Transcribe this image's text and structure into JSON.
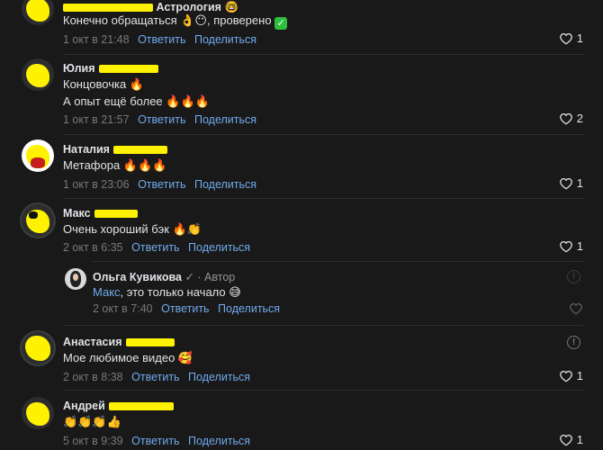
{
  "comments": [
    {
      "name": "Астрология",
      "text1": "Конечно обращаться 👌😶, проверено",
      "date": "1 окт в 21:48",
      "reply": "Ответить",
      "share": "Поделиться",
      "likes": "1"
    },
    {
      "name": "Юлия",
      "text1": "Концовочка 🔥",
      "text2": "А опыт ещё более 🔥🔥🔥",
      "date": "1 окт в 21:57",
      "reply": "Ответить",
      "share": "Поделиться",
      "likes": "2"
    },
    {
      "name": "Наталия",
      "text1": "Метафора 🔥🔥🔥",
      "date": "1 окт в 23:06",
      "reply": "Ответить",
      "share": "Поделиться",
      "likes": "1"
    },
    {
      "name": "Макс",
      "text1": "Очень хороший бэк 🔥👏",
      "date": "2 окт в 6:35",
      "reply": "Ответить",
      "share": "Поделиться",
      "likes": "1"
    },
    {
      "name": "Анастасия",
      "text1": "Мое любимое видео 🥰",
      "date": "2 окт в 8:38",
      "reply": "Ответить",
      "share": "Поделиться",
      "likes": "1"
    },
    {
      "name": "Андрей",
      "text1": "👏👏👏👍",
      "date": "5 окт в 9:39",
      "reply": "Ответить",
      "share": "Поделиться",
      "likes": "1"
    }
  ],
  "reply": {
    "name": "Ольга Кувикова",
    "check": "✓",
    "author": "· Автор",
    "mention": "Макс",
    "text": ", это только начало 😅",
    "date": "2 окт в 7:40",
    "reply": "Ответить",
    "share": "Поделиться"
  },
  "icons": {
    "like": "heart-icon",
    "info": "info-icon",
    "verified": "check-icon"
  }
}
